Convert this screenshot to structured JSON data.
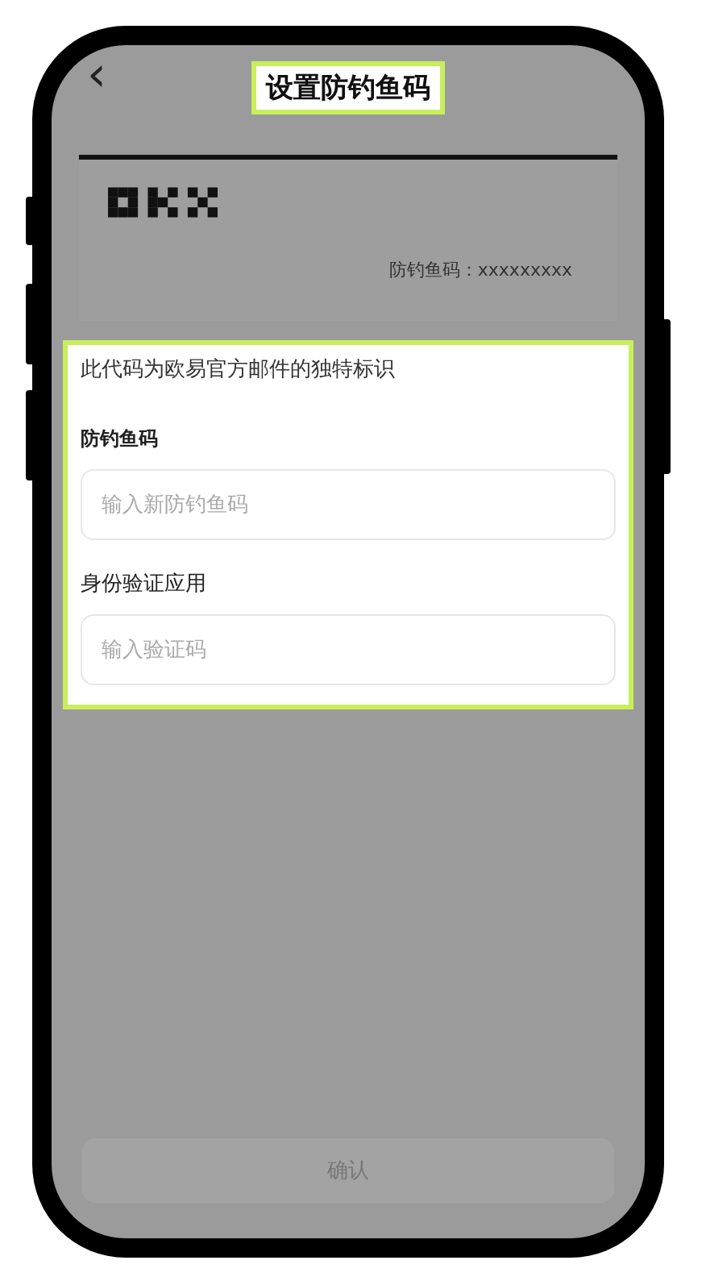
{
  "header": {
    "back_icon": "‹",
    "title": "设置防钓鱼码"
  },
  "preview": {
    "code_label": "防钓鱼码：xxxxxxxxx"
  },
  "form": {
    "description": "此代码为欧易官方邮件的独特标识",
    "fields": [
      {
        "label": "防钓鱼码",
        "placeholder": "输入新防钓鱼码"
      },
      {
        "label": "身份验证应用",
        "placeholder": "输入验证码"
      }
    ]
  },
  "confirm_button": {
    "label": "确认",
    "disabled": true
  }
}
